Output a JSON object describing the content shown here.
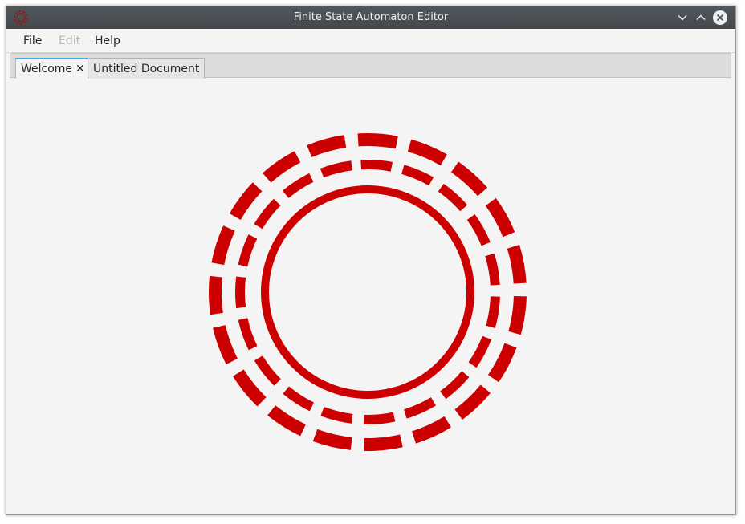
{
  "window": {
    "title": "Finite State Automaton Editor",
    "icons": {
      "app": "app-logo-icon",
      "minimize": "chevron-down-icon",
      "maximize": "chevron-up-icon",
      "close": "close-icon"
    }
  },
  "menubar": {
    "items": [
      {
        "label": "File",
        "enabled": true
      },
      {
        "label": "Edit",
        "enabled": false
      },
      {
        "label": "Help",
        "enabled": true
      }
    ]
  },
  "tabs": [
    {
      "label": "Welcome",
      "active": true,
      "closable": true,
      "close_glyph": "✕"
    },
    {
      "label": "Untitled Document",
      "active": false,
      "closable": false
    }
  ],
  "welcome": {
    "graphic": "concentric-rings-logo",
    "ring_color": "#cc0000"
  },
  "colors": {
    "accent": "#3daee9",
    "titlebar": "#4a4f54",
    "logo_red": "#cc0000"
  }
}
